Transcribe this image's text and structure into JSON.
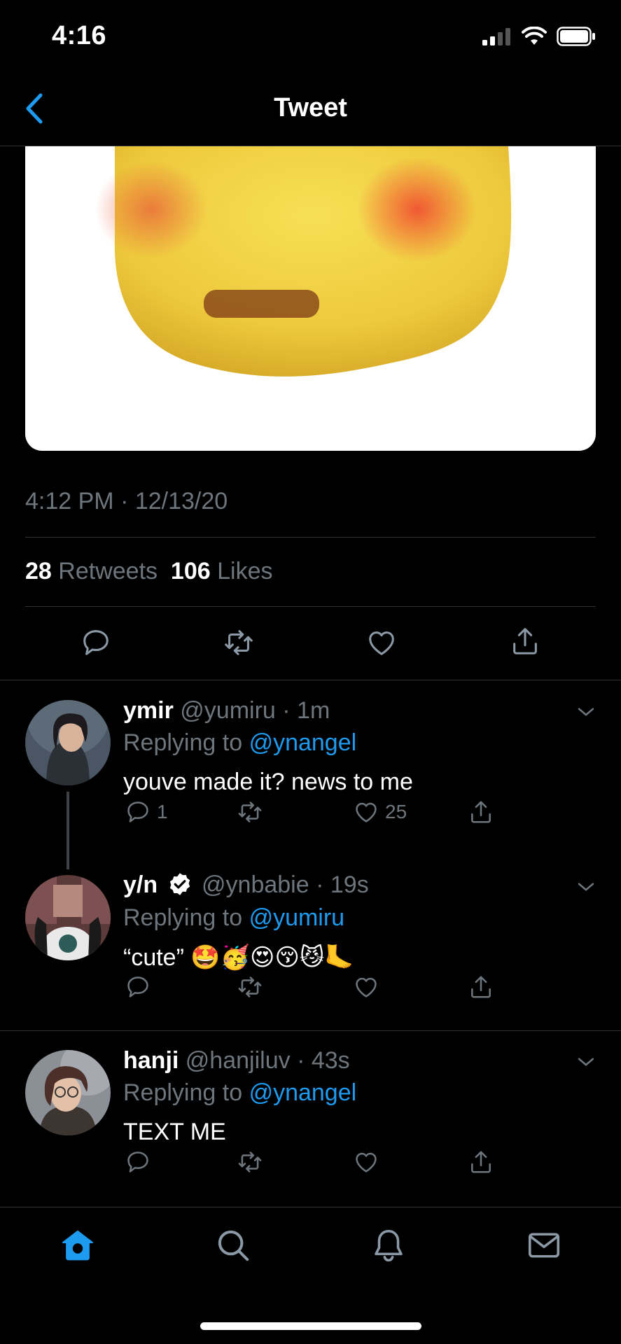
{
  "status_bar": {
    "time": "4:16"
  },
  "nav": {
    "title": "Tweet"
  },
  "tweet": {
    "timestamp": "4:12 PM · 12/13/20",
    "retweets_count": "28",
    "retweets_label": "Retweets",
    "likes_count": "106",
    "likes_label": "Likes"
  },
  "replies": [
    {
      "name": "ymir",
      "handle": "@yumiru",
      "time": "· 1m",
      "replying_label": "Replying to",
      "replying_to": "@ynangel",
      "text": "youve made it? news to me",
      "reply_count": "1",
      "retweet_count": "",
      "like_count": "25"
    },
    {
      "name": "y/n",
      "handle": "@ynbabie",
      "time": "· 19s",
      "replying_label": "Replying to",
      "replying_to": "@yumiru",
      "text": "“cute” 🤩🥳😍😚😼🦶",
      "reply_count": "",
      "retweet_count": "",
      "like_count": ""
    },
    {
      "name": "hanji",
      "handle": "@hanjiluv",
      "time": "· 43s",
      "replying_label": "Replying to",
      "replying_to": "@ynangel",
      "text": "TEXT ME",
      "reply_count": "",
      "retweet_count": "",
      "like_count": ""
    }
  ],
  "colors": {
    "accent": "#1d9bf0",
    "muted": "#6e767d",
    "divider": "#2f3336",
    "background": "#000000"
  },
  "icons": {
    "back": "chevron-left-icon",
    "reply": "speech-bubble-icon",
    "retweet": "retweet-icon",
    "like": "heart-icon",
    "share": "share-icon",
    "tabs": [
      "home-icon",
      "search-icon",
      "bell-icon",
      "mail-icon"
    ]
  }
}
